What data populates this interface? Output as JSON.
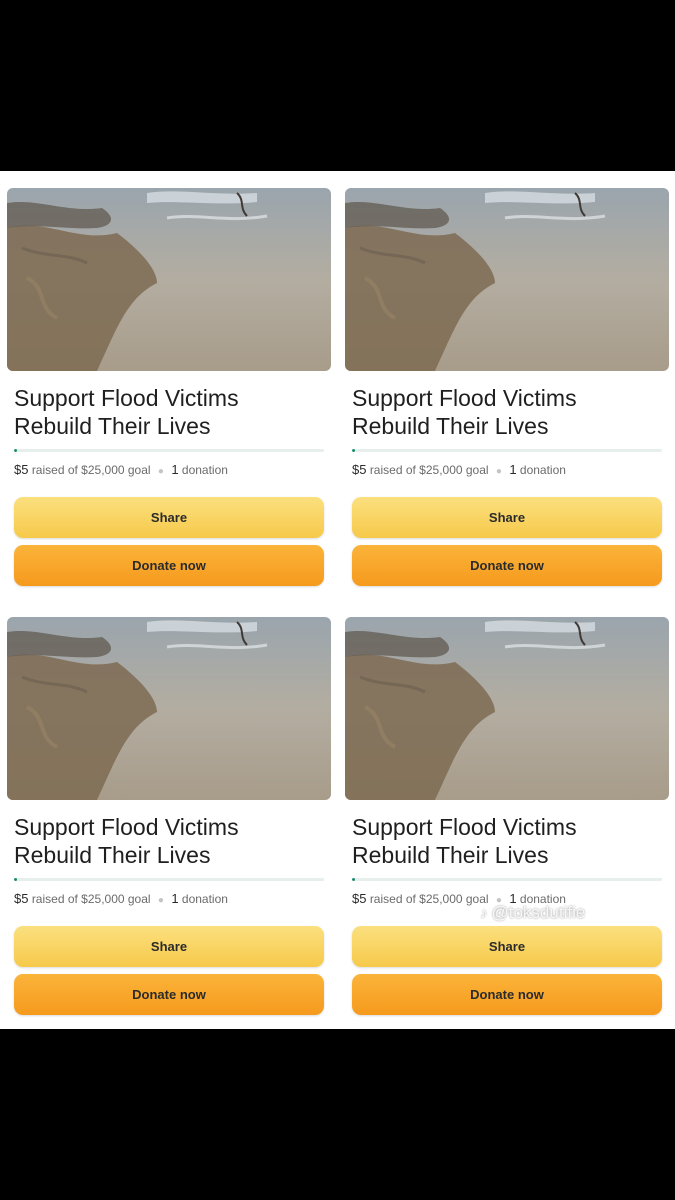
{
  "cards": [
    {
      "title_line1": "Support Flood Victims",
      "title_line2": "Rebuild Their Lives",
      "raised_amount": "$5",
      "raised_text": "raised of $25,000 goal",
      "donation_count": "1",
      "donation_label": "donation",
      "progress_fraction": 0.0002,
      "share_label": "Share",
      "donate_label": "Donate now"
    },
    {
      "title_line1": "Support Flood Victims",
      "title_line2": "Rebuild Their Lives",
      "raised_amount": "$5",
      "raised_text": "raised of $25,000 goal",
      "donation_count": "1",
      "donation_label": "donation",
      "progress_fraction": 0.0002,
      "share_label": "Share",
      "donate_label": "Donate now"
    },
    {
      "title_line1": "Support Flood Victims",
      "title_line2": "Rebuild Their Lives",
      "raised_amount": "$5",
      "raised_text": "raised of $25,000 goal",
      "donation_count": "1",
      "donation_label": "donation",
      "progress_fraction": 0.0002,
      "share_label": "Share",
      "donate_label": "Donate now"
    },
    {
      "title_line1": "Support Flood Victims",
      "title_line2": "Rebuild Their Lives",
      "raised_amount": "$5",
      "raised_text": "raised of $25,000 goal",
      "donation_count": "1",
      "donation_label": "donation",
      "progress_fraction": 0.0002,
      "share_label": "Share",
      "donate_label": "Donate now"
    }
  ],
  "watermark": {
    "icon": "tiktok-icon",
    "text": "@toksdutifie"
  },
  "colors": {
    "progress": "#178a6e",
    "share_button": "#f8d35e",
    "donate_button": "#f7a62a",
    "frame": "#000000"
  }
}
